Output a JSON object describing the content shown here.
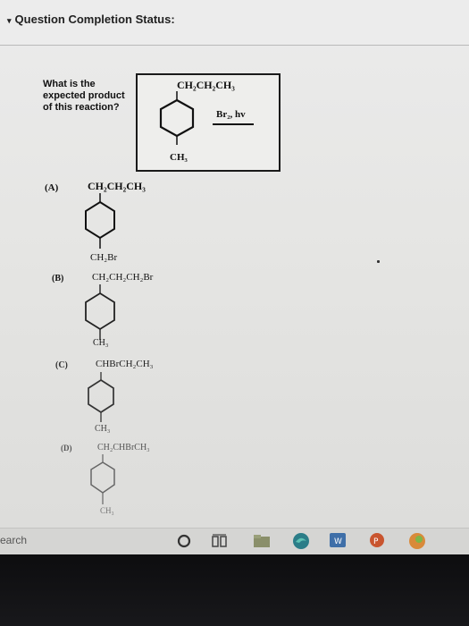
{
  "header": {
    "title": "Question Completion Status:"
  },
  "question": {
    "line1": "What is the",
    "line2": "expected product",
    "line3": "of this reaction?"
  },
  "reaction": {
    "top_group": "CH₂CH₂CH₃",
    "bottom_group": "CH₃",
    "reagent": "Br₂, hv"
  },
  "choices": [
    {
      "label": "(A)",
      "top": "CH₂CH₂CH₃",
      "bottom": "CH₂Br"
    },
    {
      "label": "(B)",
      "top": "CH₂CH₂CH₂Br",
      "bottom": "CH₃"
    },
    {
      "label": "(C)",
      "top": "CHBrCH₂CH₃",
      "bottom": "CH₃"
    },
    {
      "label": "(D)",
      "top": "CH₂CHBrCH₃",
      "bottom": "CH₃"
    }
  ],
  "taskbar": {
    "search_text": "earch"
  },
  "colors": {
    "bezel": "#0d0d0f",
    "screen": "#e6e6e4"
  }
}
